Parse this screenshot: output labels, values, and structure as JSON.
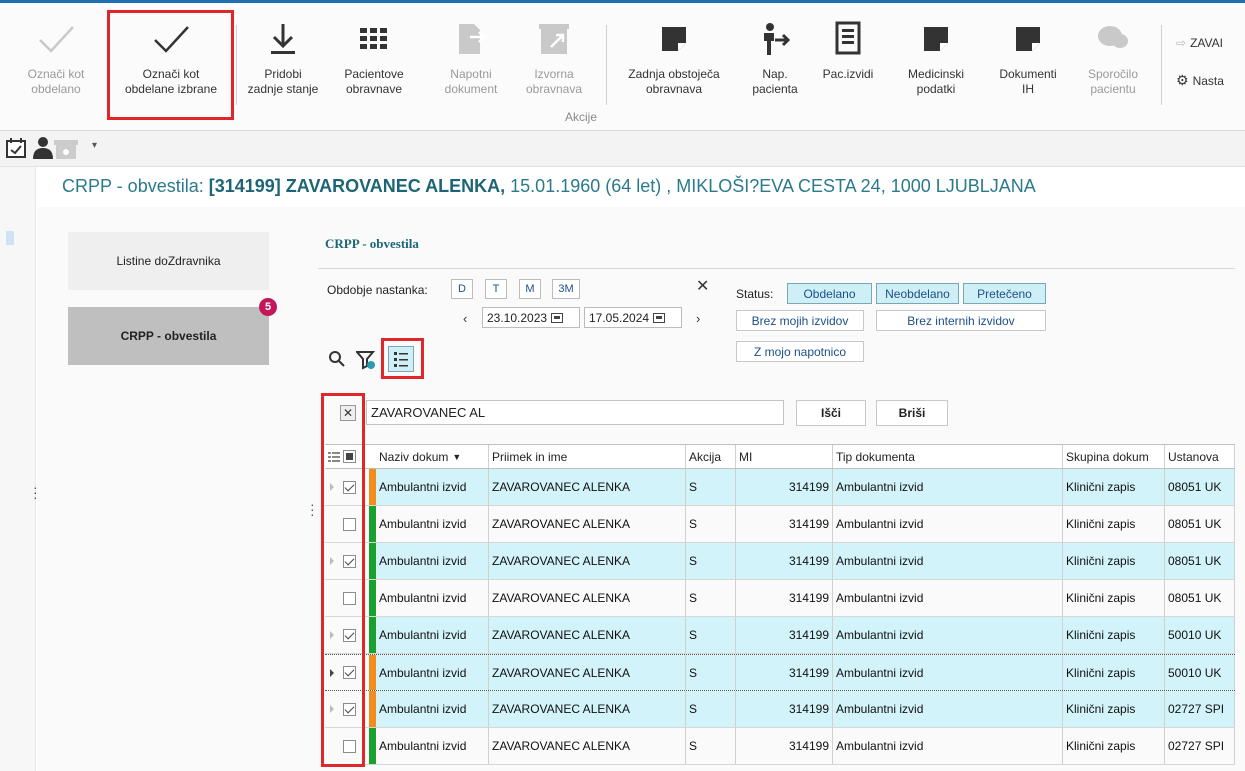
{
  "ribbon": {
    "buttons": [
      {
        "id": "oznaci-kot-obdelano",
        "label": "Označi kot\nobdelano",
        "disabled": true
      },
      {
        "id": "oznaci-kot-obdelane-izbrane",
        "label": "Označi kot\nobdelane izbrane",
        "disabled": false
      },
      {
        "id": "pridobi-zadnje-stanje",
        "label": "Pridobi\nzadnje stanje",
        "disabled": false
      },
      {
        "id": "pacientove-obravnave",
        "label": "Pacientove\nobravnave",
        "disabled": false
      },
      {
        "id": "napotni-dokument",
        "label": "Napotni\ndokument",
        "disabled": true
      },
      {
        "id": "izvorna-obravnava",
        "label": "Izvorna\nobravnava",
        "disabled": true
      },
      {
        "id": "zadnja-obstojeca-obravnava",
        "label": "Zadnja obstoječa\nobravnava",
        "disabled": false
      },
      {
        "id": "nap-pacienta",
        "label": "Nap.\npacienta",
        "disabled": false
      },
      {
        "id": "pac-izvidi",
        "label": "Pac.izvidi",
        "disabled": false
      },
      {
        "id": "medicinski-podatki",
        "label": "Medicinski\npodatki",
        "disabled": false
      },
      {
        "id": "dokumenti-ih",
        "label": "Dokumenti\nIH",
        "disabled": false
      },
      {
        "id": "sporocilo-pacientu",
        "label": "Sporočilo\npacientu",
        "disabled": true
      }
    ],
    "group_label": "Akcije",
    "right_top": "ZAVAI",
    "right_bottom": "Nasta"
  },
  "header": {
    "prefix": "CRPP - obvestila:",
    "patient": "[314199] ZAVAROVANEC ALENKA,",
    "details": "15.01.1960 (64 let) , MIKLOŠI?EVA CESTA 24, 1000  LJUBLJANA"
  },
  "sidenav": {
    "item1": "Listine doZdravnika",
    "item2": "CRPP - obvestila",
    "badge": "5"
  },
  "filter": {
    "title": "CRPP - obvestila",
    "period_label": "Obdobje nastanka:",
    "period_buttons": [
      "D",
      "T",
      "M",
      "3M"
    ],
    "date_from": "23.10.2023",
    "date_to": "17.05.2024",
    "status_label": "Status:",
    "status_buttons": [
      "Obdelano",
      "Neobdelano",
      "Pretečeno"
    ],
    "brez_mojih": "Brez mojih izvidov",
    "brez_internih": "Brez internih izvidov",
    "z_mojo": "Z mojo napotnico"
  },
  "search": {
    "value": "ZAVAROVANEC AL",
    "isci": "Išči",
    "brisi": "Briši"
  },
  "grid": {
    "columns": [
      "Naziv dokum",
      "Priimek in ime",
      "Akcija",
      "MI",
      "Tip dokumenta",
      "Skupina dokum",
      "Ustanova"
    ],
    "rows": [
      {
        "checked": true,
        "color": "#f28c1d",
        "naziv": "Ambulantni izvid",
        "ime": "ZAVAROVANEC ALENKA",
        "akcija": "S",
        "mi": "314199",
        "tip": "Ambulantni izvid",
        "skupina": "Klinični zapis",
        "ustanova": "08051 UK"
      },
      {
        "checked": false,
        "color": "#1aa12d",
        "naziv": "Ambulantni izvid",
        "ime": "ZAVAROVANEC ALENKA",
        "akcija": "S",
        "mi": "314199",
        "tip": "Ambulantni izvid",
        "skupina": "Klinični zapis",
        "ustanova": "08051 UK"
      },
      {
        "checked": true,
        "color": "#1aa12d",
        "naziv": "Ambulantni izvid",
        "ime": "ZAVAROVANEC ALENKA",
        "akcija": "S",
        "mi": "314199",
        "tip": "Ambulantni izvid",
        "skupina": "Klinični zapis",
        "ustanova": "08051 UK"
      },
      {
        "checked": false,
        "color": "#1aa12d",
        "naziv": "Ambulantni izvid",
        "ime": "ZAVAROVANEC ALENKA",
        "akcija": "S",
        "mi": "314199",
        "tip": "Ambulantni izvid",
        "skupina": "Klinični zapis",
        "ustanova": "08051 UK"
      },
      {
        "checked": true,
        "color": "#1aa12d",
        "naziv": "Ambulantni izvid",
        "ime": "ZAVAROVANEC ALENKA",
        "akcija": "S",
        "mi": "314199",
        "tip": "Ambulantni izvid",
        "skupina": "Klinični zapis",
        "ustanova": "50010 UK"
      },
      {
        "checked": true,
        "color": "#f28c1d",
        "naziv": "Ambulantni izvid",
        "ime": "ZAVAROVANEC ALENKA",
        "akcija": "S",
        "mi": "314199",
        "tip": "Ambulantni izvid",
        "skupina": "Klinični zapis",
        "ustanova": "50010 UK"
      },
      {
        "checked": true,
        "color": "#f28c1d",
        "naziv": "Ambulantni izvid",
        "ime": "ZAVAROVANEC ALENKA",
        "akcija": "S",
        "mi": "314199",
        "tip": "Ambulantni izvid",
        "skupina": "Klinični zapis",
        "ustanova": "02727 SPI"
      },
      {
        "checked": false,
        "color": "#1aa12d",
        "naziv": "Ambulantni izvid",
        "ime": "ZAVAROVANEC ALENKA",
        "akcija": "S",
        "mi": "314199",
        "tip": "Ambulantni izvid",
        "skupina": "Klinični zapis",
        "ustanova": "02727 SPI"
      }
    ]
  },
  "colors": {
    "accent": "#1d6576",
    "highlight": "#e0262b",
    "selected_row": "#d2f3f9",
    "badge": "#c2185b"
  }
}
